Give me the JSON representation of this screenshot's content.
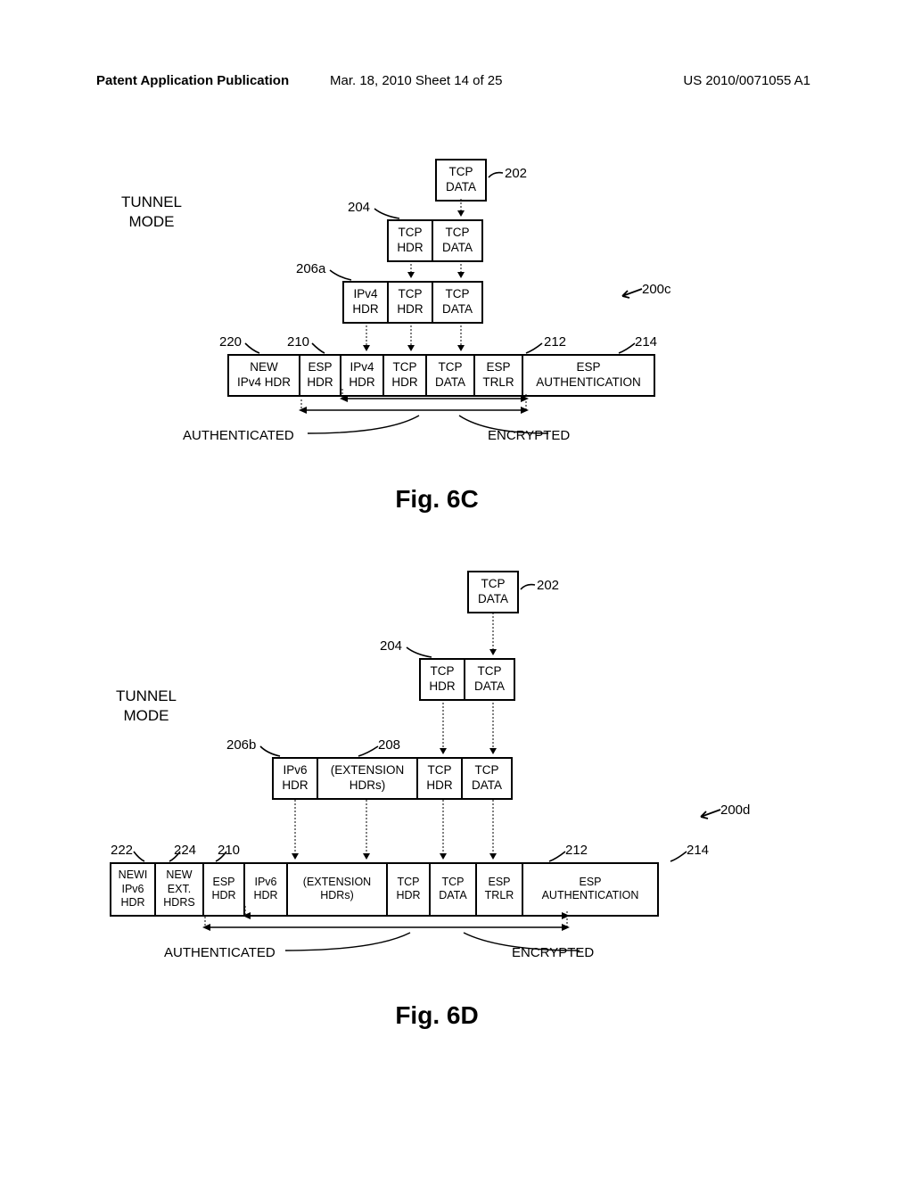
{
  "header": {
    "left": "Patent Application Publication",
    "center": "Mar. 18, 2010   Sheet 14 of 25",
    "right": "US 2010/0071055 A1"
  },
  "labels": {
    "tunnel_mode": "TUNNEL\nMODE",
    "fig_6c": "Fig. 6C",
    "fig_6d": "Fig. 6D",
    "authenticated": "AUTHENTICATED",
    "encrypted": "ENCRYPTED"
  },
  "refs": {
    "r200c": "200c",
    "r200d": "200d",
    "r202": "202",
    "r204": "204",
    "r206a": "206a",
    "r206b": "206b",
    "r208": "208",
    "r210": "210",
    "r212": "212",
    "r214": "214",
    "r220": "220",
    "r222": "222",
    "r224": "224"
  },
  "cells": {
    "tcp_data": "TCP\nDATA",
    "tcp_hdr": "TCP\nHDR",
    "ipv4_hdr": "IPv4\nHDR",
    "ipv6_hdr": "IPv6\nHDR",
    "ext_hdrs": "(EXTENSION\nHDRs)",
    "new_ipv4_hdr": "NEW\nIPv4 HDR",
    "new_ipv6_hdr": "NEWI\nIPv6\nHDR",
    "new_ext_hdrs": "NEW\nEXT.\nHDRS",
    "esp_hdr": "ESP\nHDR",
    "esp_trlr": "ESP\nTRLR",
    "esp_auth": "ESP\nAUTHENTICATION"
  },
  "chart_data": [
    {
      "type": "table",
      "title": "Fig. 6C — IPv4 ESP Tunnel Mode Encapsulation (200c)",
      "stages": [
        {
          "ref": "202",
          "fields": [
            "TCP DATA"
          ]
        },
        {
          "ref": "204",
          "fields": [
            "TCP HDR",
            "TCP DATA"
          ]
        },
        {
          "ref": "206a",
          "fields": [
            "IPv4 HDR",
            "TCP HDR",
            "TCP DATA"
          ]
        },
        {
          "ref": null,
          "fields": [
            "NEW IPv4 HDR",
            "ESP HDR",
            "IPv4 HDR",
            "TCP HDR",
            "TCP DATA",
            "ESP TRLR",
            "ESP AUTHENTICATION"
          ],
          "field_refs": {
            "NEW IPv4 HDR": "220",
            "ESP HDR": "210",
            "ESP TRLR": "212",
            "ESP AUTHENTICATION": "214"
          },
          "encrypted_span": [
            "IPv4 HDR",
            "ESP TRLR"
          ],
          "authenticated_span": [
            "ESP HDR",
            "ESP TRLR"
          ]
        }
      ]
    },
    {
      "type": "table",
      "title": "Fig. 6D — IPv6 ESP Tunnel Mode Encapsulation (200d)",
      "stages": [
        {
          "ref": "202",
          "fields": [
            "TCP DATA"
          ]
        },
        {
          "ref": "204",
          "fields": [
            "TCP HDR",
            "TCP DATA"
          ]
        },
        {
          "ref": "206b/208",
          "fields": [
            "IPv6 HDR",
            "(EXTENSION HDRs)",
            "TCP HDR",
            "TCP DATA"
          ]
        },
        {
          "ref": null,
          "fields": [
            "NEW IPv6 HDR",
            "NEW EXT. HDRS",
            "ESP HDR",
            "IPv6 HDR",
            "(EXTENSION HDRs)",
            "TCP HDR",
            "TCP DATA",
            "ESP TRLR",
            "ESP AUTHENTICATION"
          ],
          "field_refs": {
            "NEW IPv6 HDR": "222",
            "NEW EXT. HDRS": "224",
            "ESP HDR": "210",
            "ESP TRLR": "212",
            "ESP AUTHENTICATION": "214"
          },
          "encrypted_span": [
            "IPv6 HDR",
            "ESP TRLR"
          ],
          "authenticated_span": [
            "ESP HDR",
            "ESP TRLR"
          ]
        }
      ]
    }
  ]
}
